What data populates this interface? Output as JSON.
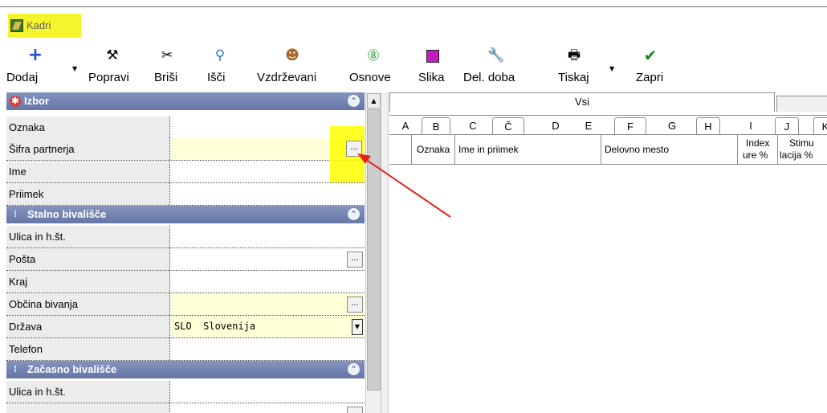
{
  "window": {
    "title": "Kadri"
  },
  "toolbar": {
    "dodaj": "Dodaj",
    "popravi": "Popravi",
    "brisi": "Briši",
    "isci": "Išči",
    "vzdrzevani": "Vzdrževani",
    "osnove": "Osnove",
    "slika": "Slika",
    "del_doba": "Del. doba",
    "tiskaj": "Tiskaj",
    "zapri": "Zapri"
  },
  "sections": {
    "izbor": "Izbor",
    "stalno": "Stalno bivališče",
    "zacasno": "Začasno bivališče"
  },
  "fields": {
    "oznaka": "Oznaka",
    "sifra_partnerja": "Šifra partnerja",
    "ime": "Ime",
    "priimek": "Priimek",
    "ulica": "Ulica in h.št.",
    "posta": "Pošta",
    "kraj": "Kraj",
    "obcina": "Občina bivanja",
    "drzava": "Država",
    "drzava_value": "SLO  Slovenija",
    "telefon": "Telefon",
    "ulica2": "Ulica in h.št."
  },
  "browse_button": "...",
  "right": {
    "tab_vsi": "Vsi",
    "letters": [
      "A",
      "B",
      "C",
      "Č",
      "D",
      "E",
      "F",
      "G",
      "H",
      "I",
      "J",
      "K"
    ],
    "columns": {
      "oznaka": "Oznaka",
      "ime_priimek": "Ime in priimek",
      "delovno_mesto": "Delovno mesto",
      "index_1": "Index",
      "index_2": "ure %",
      "stimu_1": "Stimu",
      "stimu_2": "lacija %"
    }
  },
  "colors": {
    "section_header": "#7080b0",
    "highlight": "#ffff00",
    "arrow": "#e8231b",
    "yellow_field": "#ffffd8"
  }
}
